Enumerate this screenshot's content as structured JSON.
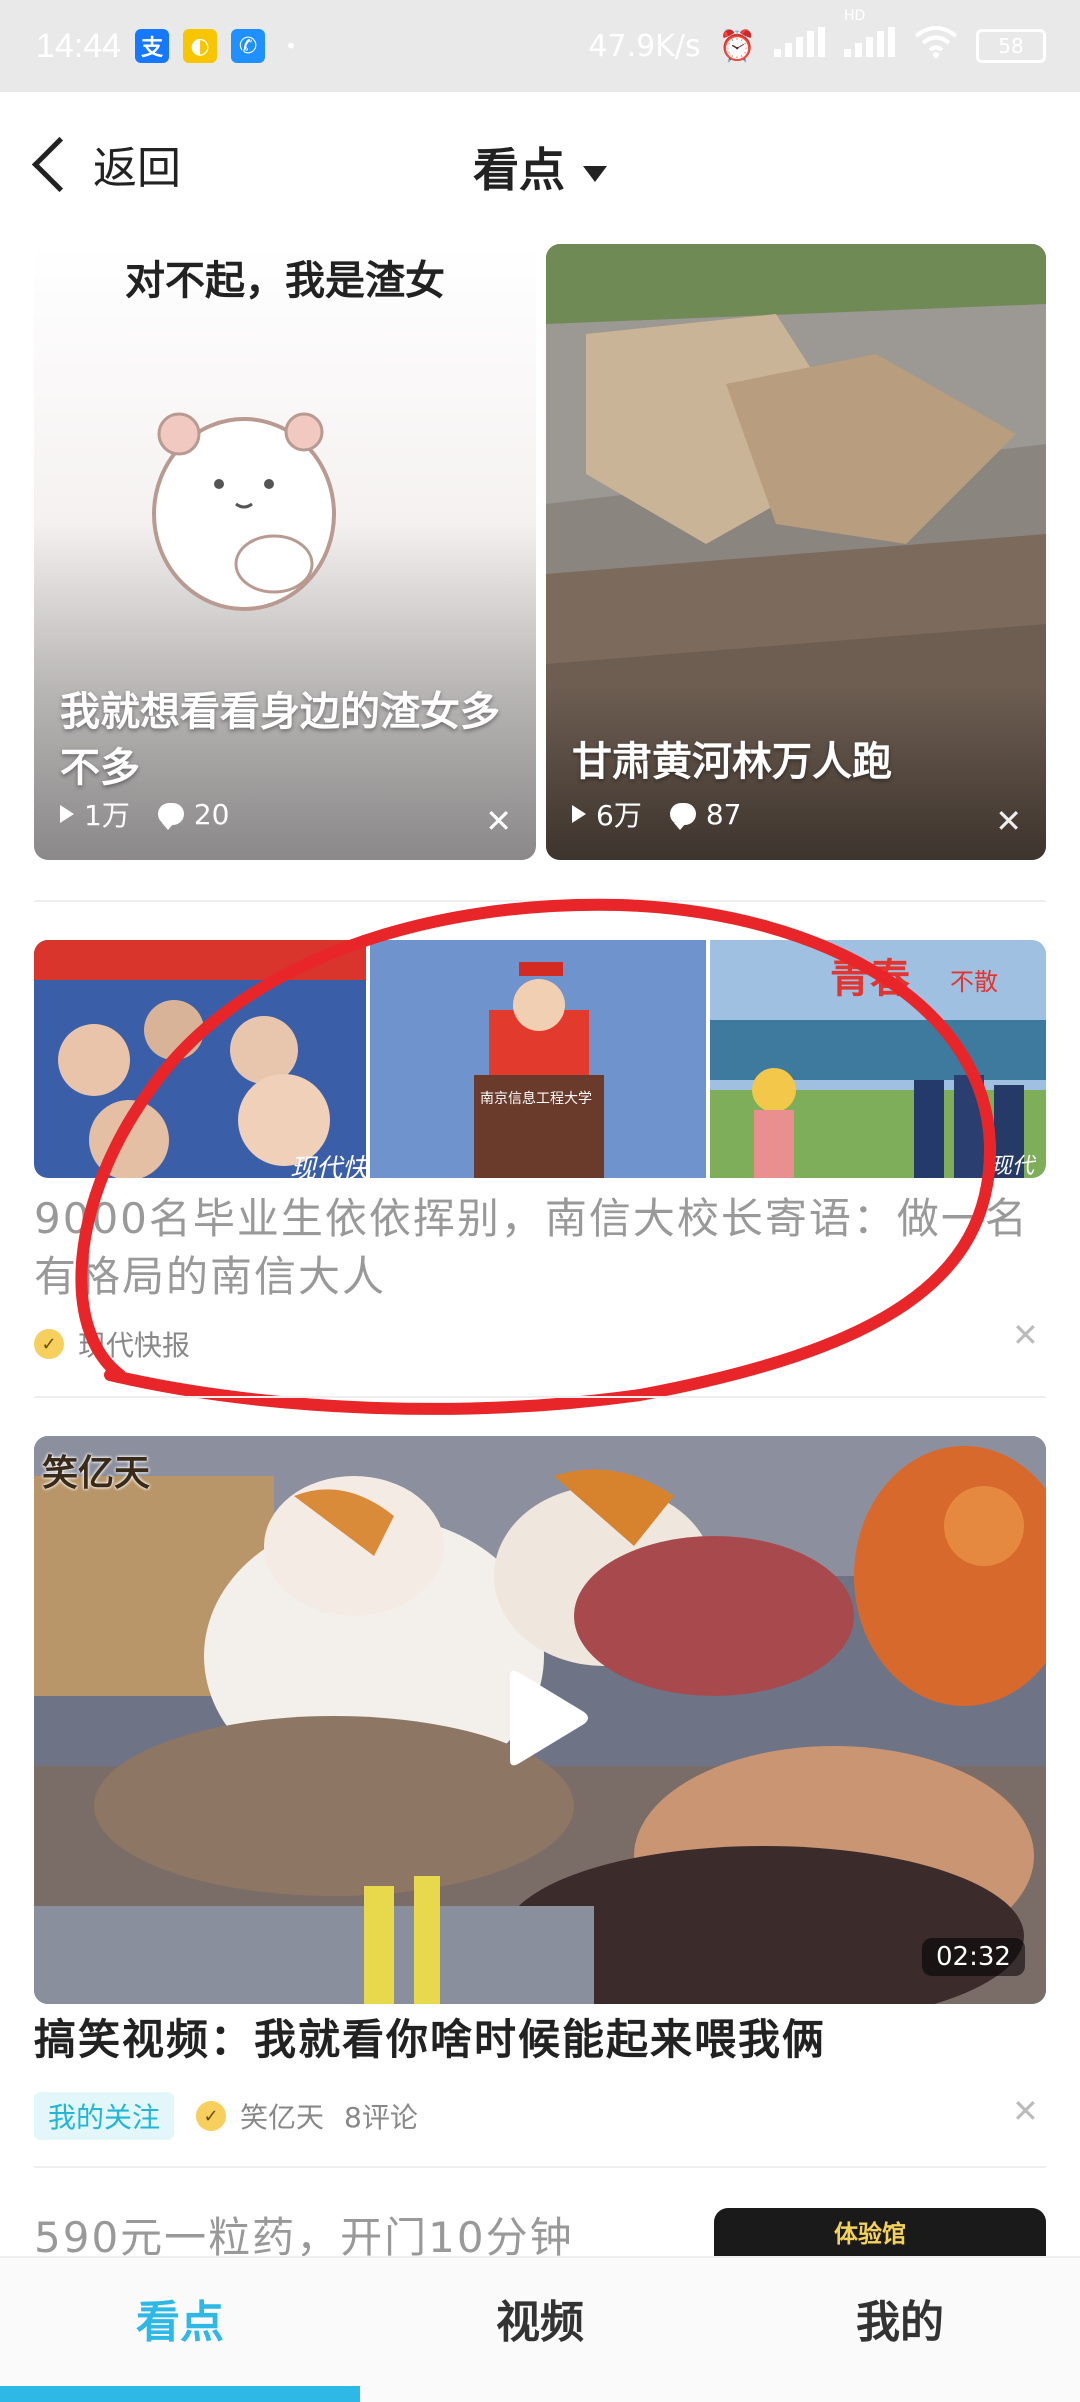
{
  "status": {
    "time": "14:44",
    "net": "47.9K/s",
    "battery": "58",
    "hd": "HD"
  },
  "nav": {
    "back_label": "返回",
    "title": "看点"
  },
  "cards": [
    {
      "image_caption": "对不起，我是渣女",
      "title": "我就想看看身边的渣女多不多",
      "plays": "1万",
      "comments": "20"
    },
    {
      "title": "甘肃黄河林万人跑",
      "plays": "6万",
      "comments": "87"
    }
  ],
  "article1": {
    "title": "9000名毕业生依依挥别，南信大校长寄语：做一名有格局的南信大人",
    "source": "现代快报",
    "img_texts": [
      "现代快",
      "青春",
      "不散",
      "现代",
      "南京信息工程大学"
    ]
  },
  "article2": {
    "watermark": "笑亿天",
    "duration": "02:32",
    "title": "搞笑视频：我就看你啥时候能起来喂我俩",
    "tag": "我的关注",
    "source": "笑亿天",
    "comments": "8评论"
  },
  "article3": {
    "title": "590元一粒药，开门10分钟",
    "thumb_text": "体验馆"
  },
  "tabs": [
    "看点",
    "视频",
    "我的"
  ],
  "colors": {
    "accent": "#2eb8e6",
    "annotation": "#e8262a"
  }
}
